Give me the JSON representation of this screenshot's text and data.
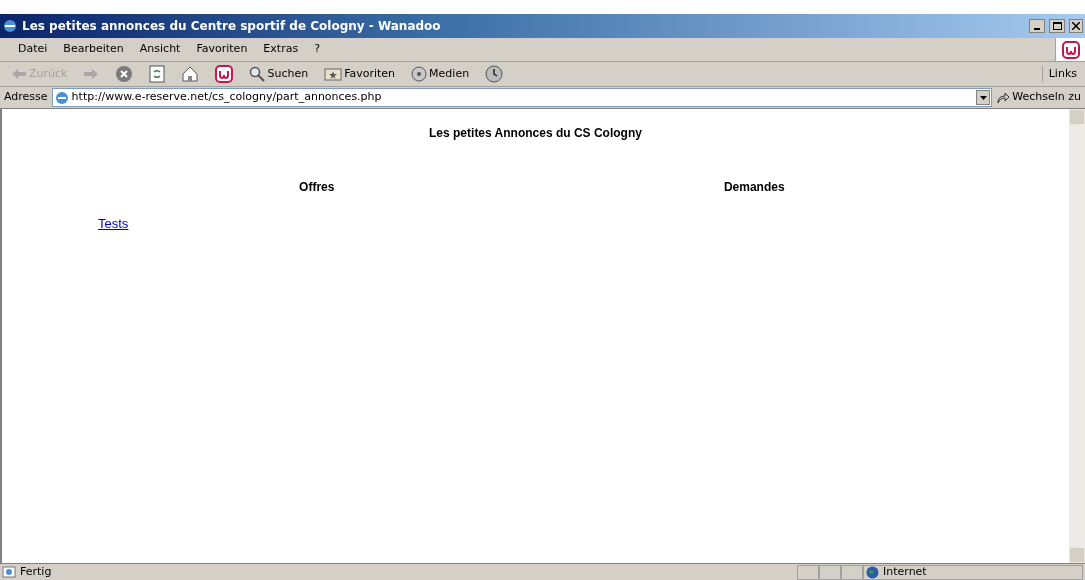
{
  "window": {
    "title": "Les petites annonces du Centre sportif de Cologny - Wanadoo"
  },
  "menu": [
    "Datei",
    "Bearbeiten",
    "Ansicht",
    "Favoriten",
    "Extras",
    "?"
  ],
  "toolbar": [
    {
      "kind": "back",
      "label": "Zurück",
      "disabled": true
    },
    {
      "kind": "forward",
      "disabled": true
    },
    {
      "kind": "stop"
    },
    {
      "kind": "refresh"
    },
    {
      "kind": "home"
    },
    {
      "kind": "brand"
    },
    {
      "kind": "search",
      "label": "Suchen"
    },
    {
      "kind": "favorites",
      "label": "Favoriten"
    },
    {
      "kind": "media",
      "label": "Medien"
    },
    {
      "kind": "history"
    }
  ],
  "links_label": "Links",
  "address": {
    "label": "Adresse",
    "value": "http://www.e-reserve.net/cs_cologny/part_annonces.php",
    "go": "Wechseln zu"
  },
  "page": {
    "heading": "Les petites Annonces du CS Cologny",
    "columns": [
      {
        "heading": "Offres",
        "links": [
          "Tests"
        ]
      },
      {
        "heading": "Demandes"
      }
    ]
  },
  "status_bar": {
    "text": "Fertig",
    "zone": "Internet"
  }
}
